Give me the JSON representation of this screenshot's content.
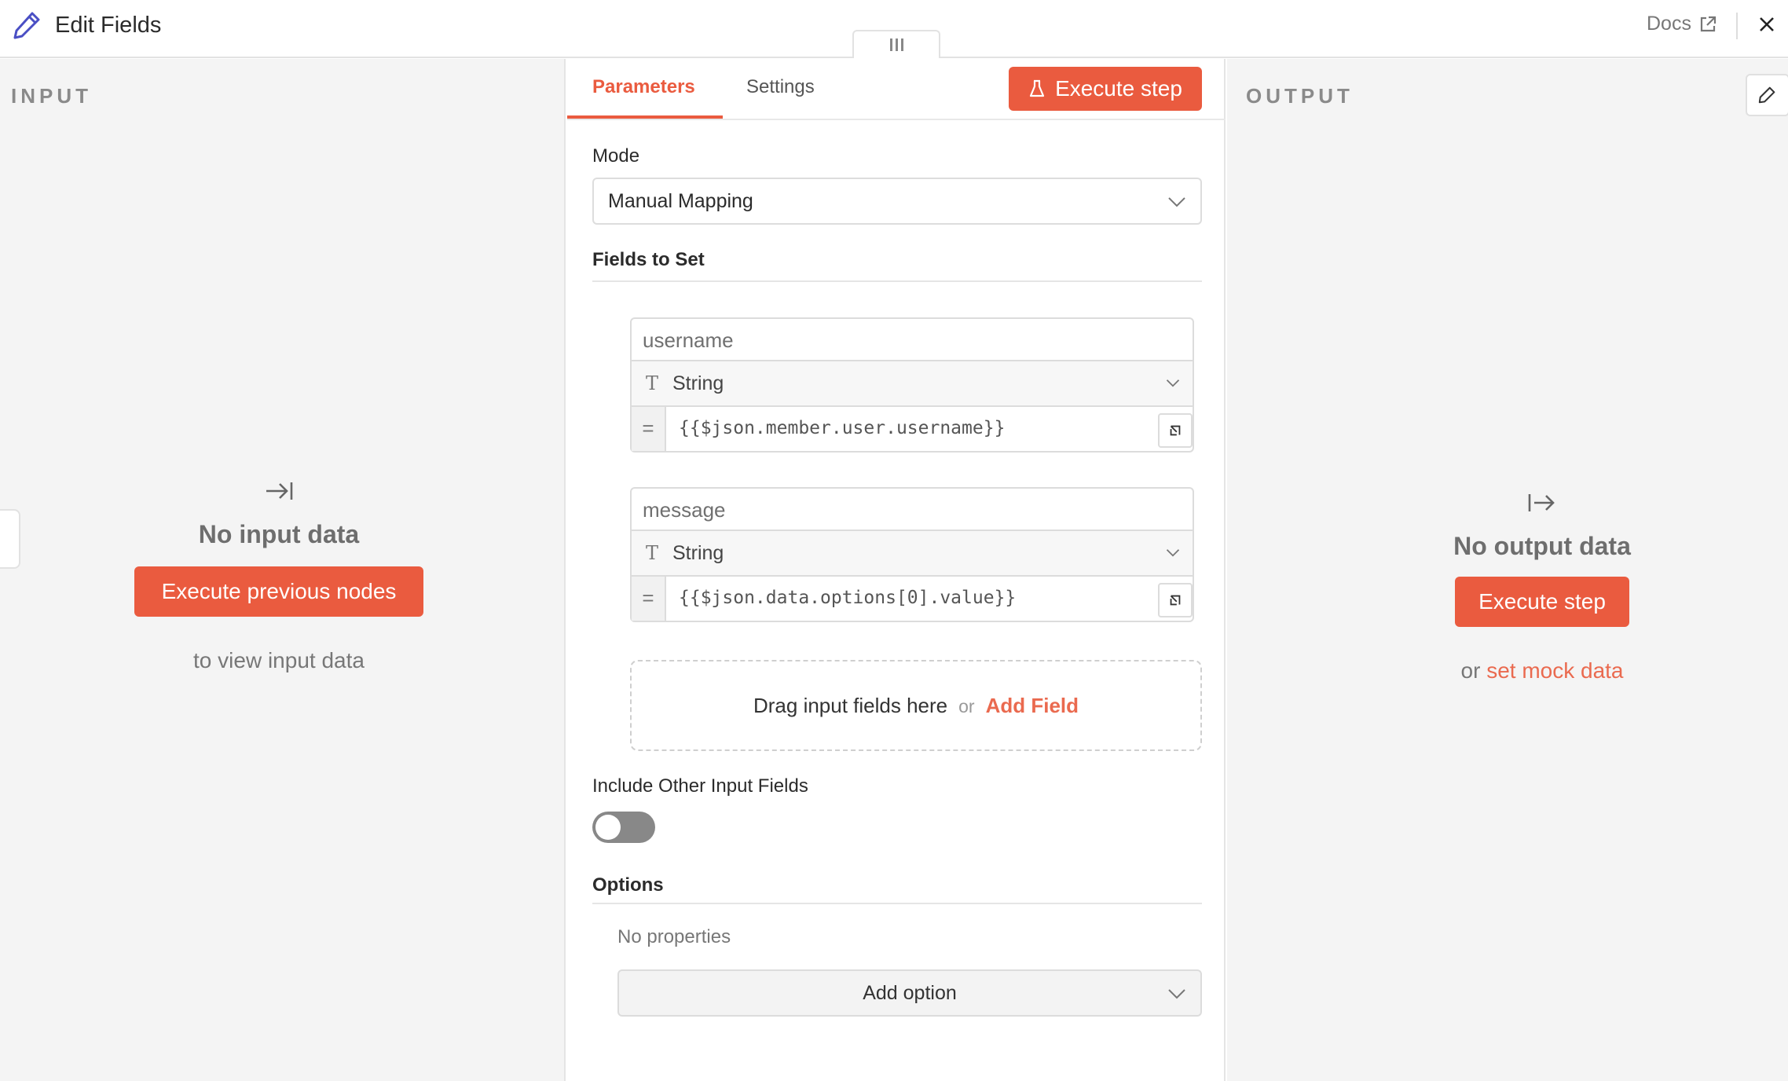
{
  "header": {
    "title": "Edit Fields",
    "docs_label": "Docs",
    "icons": [
      "pencil-icon",
      "external-link-icon",
      "close-icon"
    ]
  },
  "input": {
    "label": "INPUT",
    "empty_title": "No input data",
    "button": "Execute previous nodes",
    "hint": "to view input data"
  },
  "parameters": {
    "tabs": [
      {
        "label": "Parameters",
        "active": true
      },
      {
        "label": "Settings",
        "active": false
      }
    ],
    "execute_button": "Execute step",
    "mode_label": "Mode",
    "mode_value": "Manual Mapping",
    "fields_label": "Fields to Set",
    "fields": [
      {
        "name": "username",
        "type": "String",
        "value": "{{$json.member.user.username}}"
      },
      {
        "name": "message",
        "type": "String",
        "value": "{{$json.data.options[0].value}}"
      }
    ],
    "dropzone": {
      "text": "Drag input fields here",
      "or": "or",
      "add": "Add Field"
    },
    "include_label": "Include Other Input Fields",
    "include_enabled": false,
    "options_label": "Options",
    "no_properties": "No properties",
    "add_option": "Add option"
  },
  "output": {
    "label": "OUTPUT",
    "empty_title": "No output data",
    "button": "Execute step",
    "hint_prefix": "or",
    "hint_link": "set mock data"
  },
  "colors": {
    "accent": "#ea5b3f",
    "panel_bg": "#f4f4f4"
  }
}
